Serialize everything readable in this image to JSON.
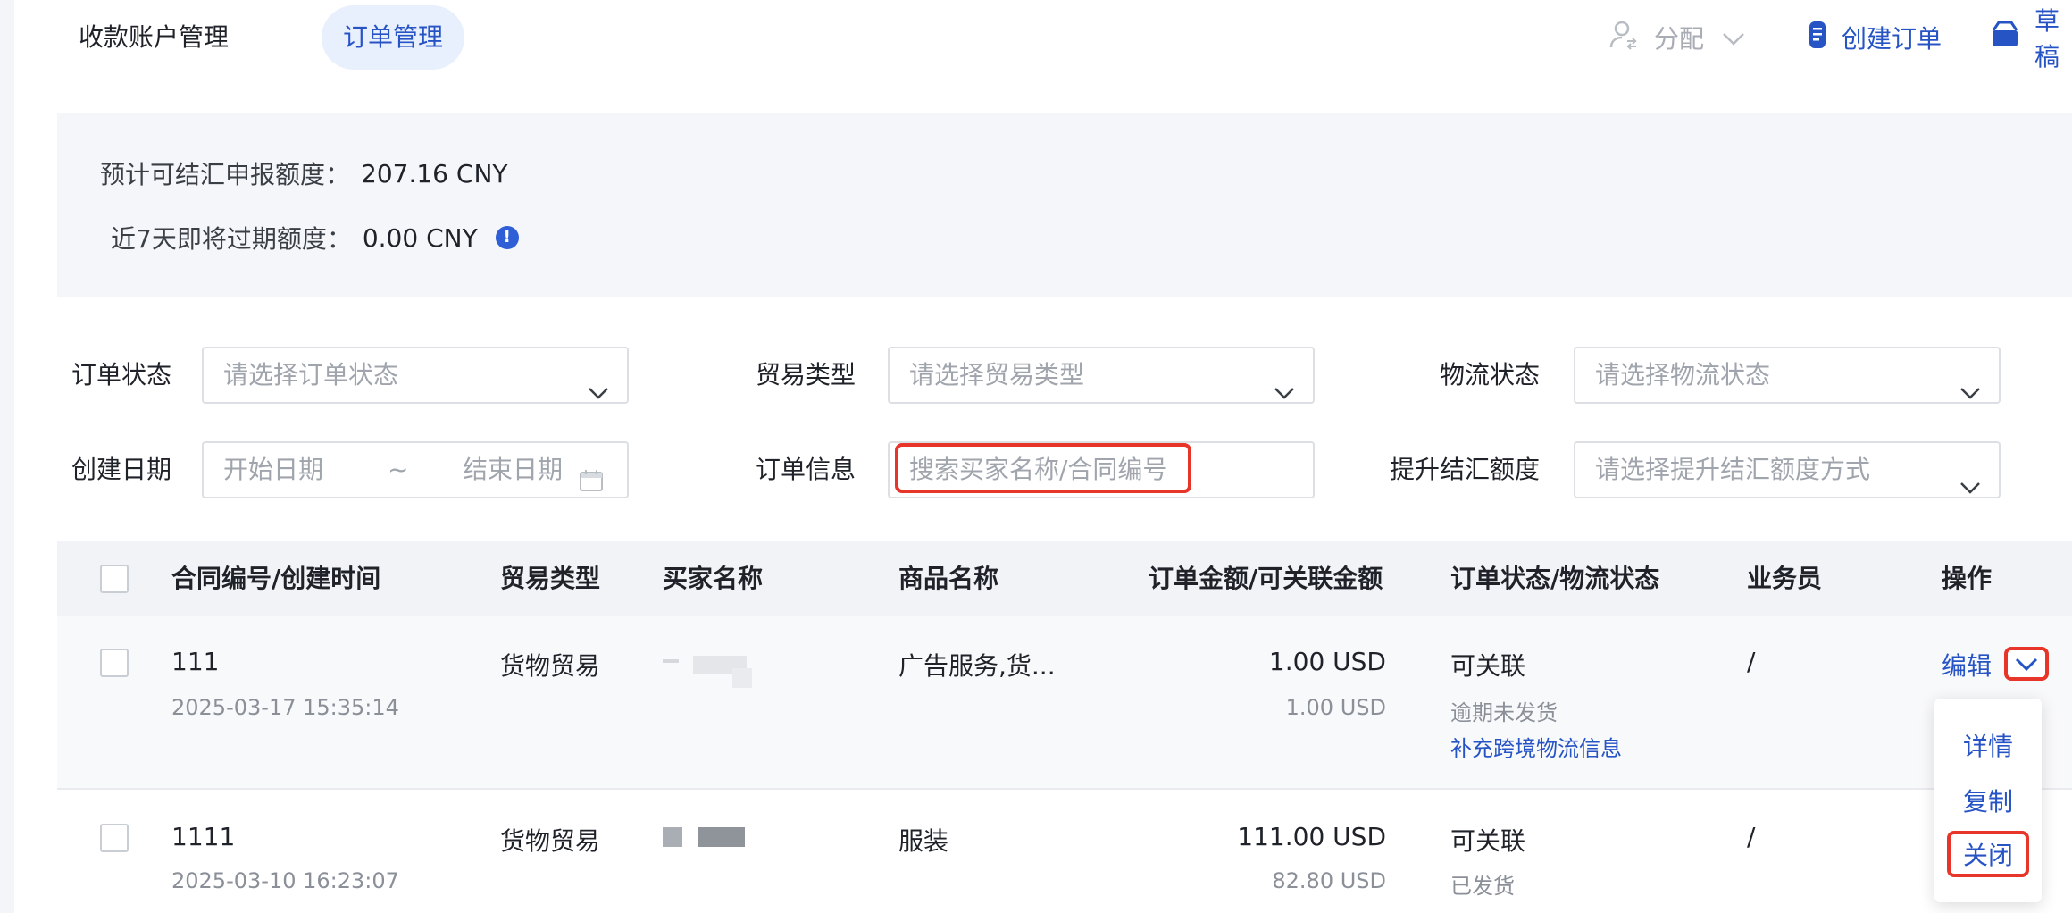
{
  "tabs": [
    "收款账户管理",
    "订单管理"
  ],
  "toolbar": {
    "assign_label": "分配",
    "create_label": "创建订单",
    "draft_label": "草稿"
  },
  "summary": {
    "declarable_label": "预计可结汇申报额度：",
    "declarable_value": "207.16 CNY",
    "expiring_label": "近7天即将过期额度：",
    "expiring_value": "0.00 CNY",
    "info_glyph": "!"
  },
  "filters": {
    "order_status": {
      "label": "订单状态",
      "placeholder": "请选择订单状态"
    },
    "trade_type": {
      "label": "贸易类型",
      "placeholder": "请选择贸易类型"
    },
    "logistics_status": {
      "label": "物流状态",
      "placeholder": "请选择物流状态"
    },
    "create_date": {
      "label": "创建日期",
      "start_placeholder": "开始日期",
      "separator": "~",
      "end_placeholder": "结束日期"
    },
    "order_info": {
      "label": "订单信息",
      "placeholder": "搜索买家名称/合同编号"
    },
    "boost_quota": {
      "label": "提升结汇额度",
      "placeholder": "请选择提升结汇额度方式"
    }
  },
  "table": {
    "headers": [
      "合同编号/创建时间",
      "贸易类型",
      "买家名称",
      "商品名称",
      "订单金额/可关联金额",
      "订单状态/物流状态",
      "业务员",
      "操作"
    ],
    "rows": [
      {
        "contract_no": "111",
        "created_at": "2025-03-17 15:35:14",
        "trade_type": "货物贸易",
        "buyer": "",
        "product": "广告服务,货...",
        "order_amount": "1.00 USD",
        "linkable_amount": "1.00 USD",
        "order_status": "可关联",
        "logistics_status": "逾期未发货",
        "logistics_link": "补充跨境物流信息",
        "salesperson": "/",
        "action_edit": "编辑"
      },
      {
        "contract_no": "1111",
        "created_at": "2025-03-10 16:23:07",
        "trade_type": "货物贸易",
        "buyer": "",
        "product": "服装",
        "order_amount": "111.00 USD",
        "linkable_amount": "82.80 USD",
        "order_status": "可关联",
        "logistics_status": "已发货",
        "salesperson": "/"
      }
    ]
  },
  "action_menu": [
    "详情",
    "复制",
    "关闭"
  ],
  "colors": {
    "accent": "#2754c5",
    "highlight": "#e8352a",
    "panel": "#f4f6fa"
  }
}
